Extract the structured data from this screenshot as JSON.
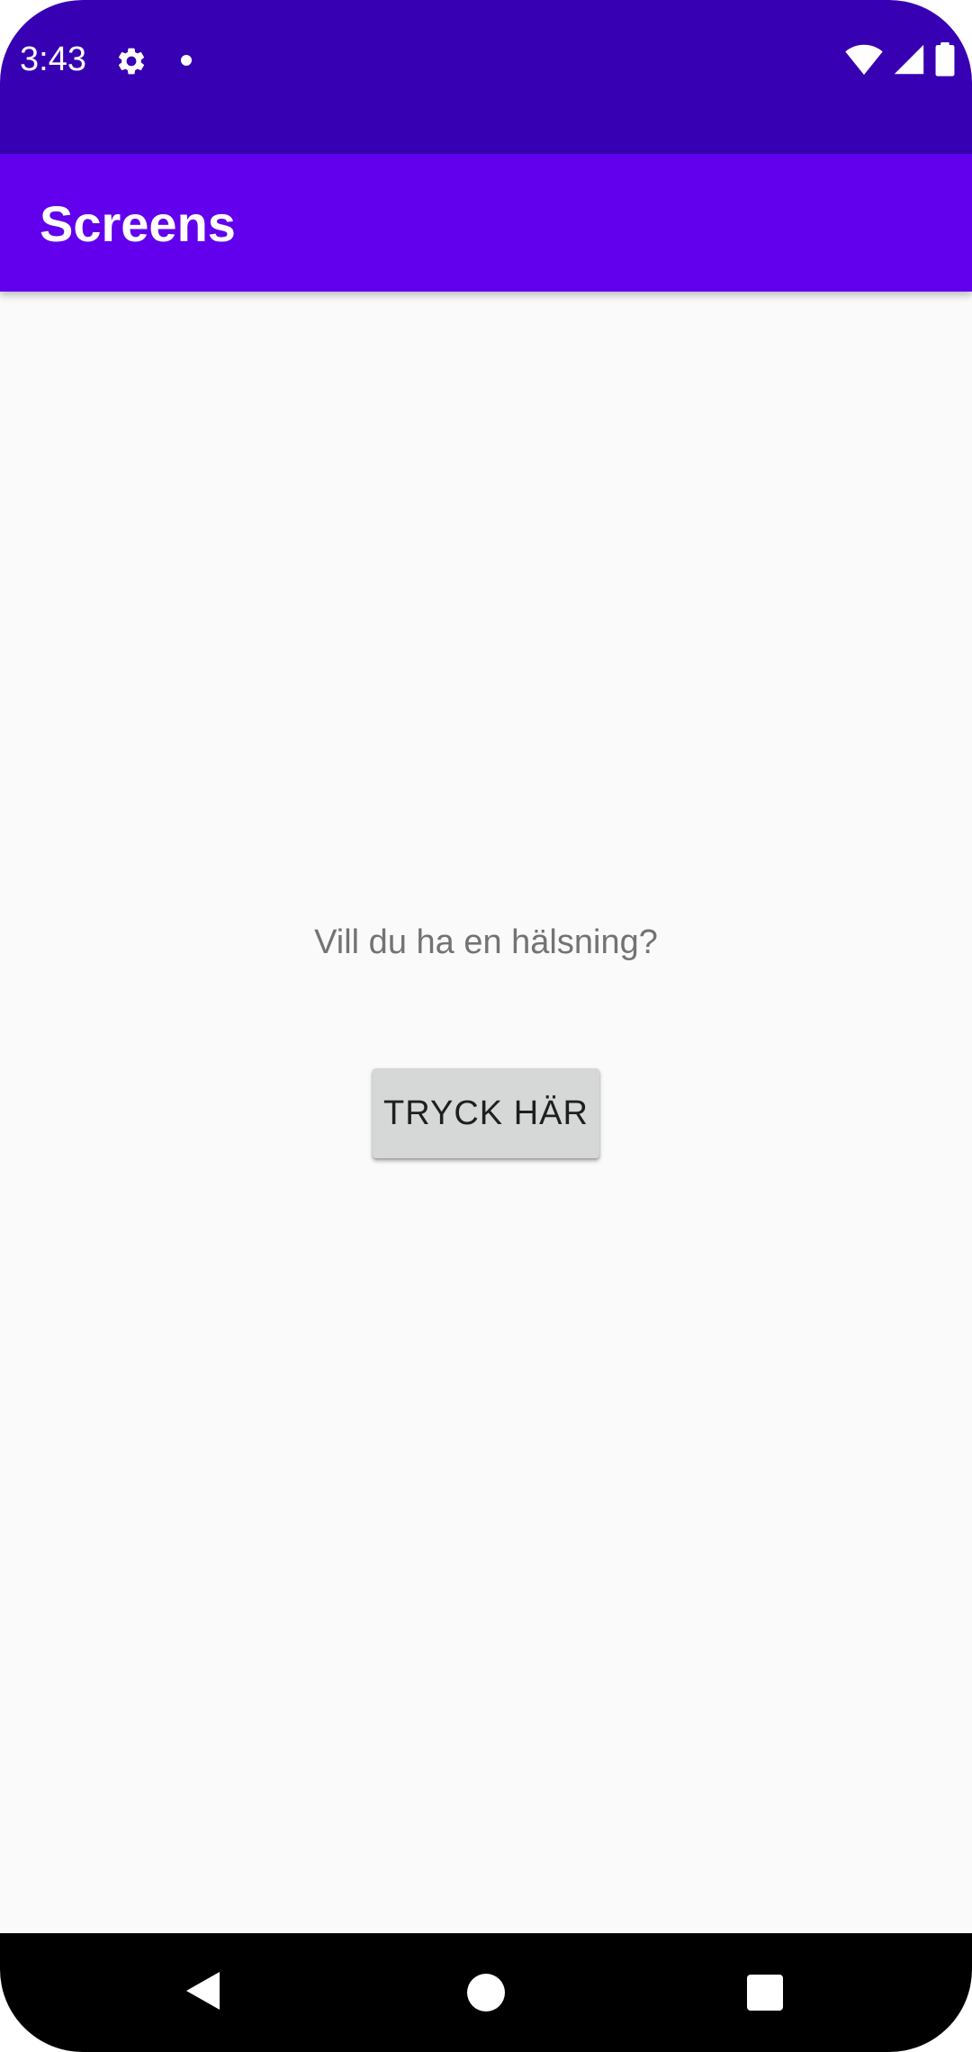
{
  "status_bar": {
    "time": "3:43",
    "left_icons": [
      "gear-icon",
      "notification-dot-icon"
    ],
    "right_icons": [
      "wifi-icon",
      "signal-icon",
      "battery-icon"
    ],
    "background": "#3700b3"
  },
  "app_bar": {
    "title": "Screens",
    "background": "#6200ee"
  },
  "main": {
    "prompt_text": "Vill du ha en hälsning?",
    "button_label": "TRYCK HÄR"
  },
  "nav_bar": {
    "buttons": [
      "back-icon",
      "home-icon",
      "recents-icon"
    ]
  }
}
